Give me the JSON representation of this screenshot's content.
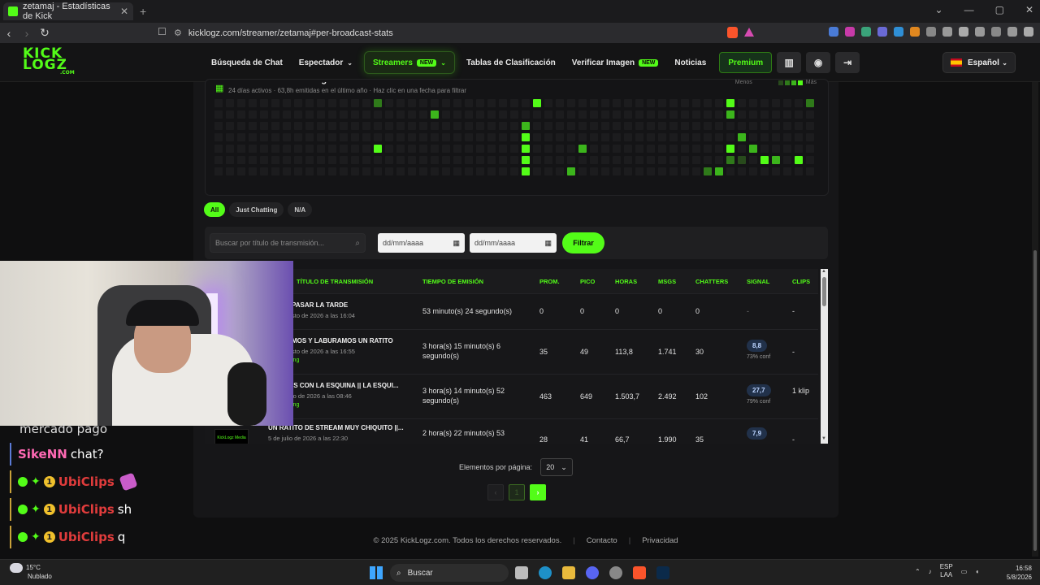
{
  "browser": {
    "tab_title": "zetamaj - Estadísticas de Kick",
    "tab_close": "✕",
    "new_tab": "+",
    "url": "kicklogz.com/streamer/zetamaj#per-broadcast-stats",
    "window_controls": [
      "⌄",
      "—",
      "▢",
      "✕"
    ]
  },
  "site": {
    "logo_line1": "KICK",
    "logo_line2": "LOGZ",
    "logo_suffix": ".COM",
    "nav": [
      {
        "label": "Búsqueda de Chat"
      },
      {
        "label": "Espectador",
        "chevron": "⌄"
      },
      {
        "label": "Streamers",
        "badge": "NEW",
        "chevron": "⌄",
        "active": true
      },
      {
        "label": "Tablas de Clasificación"
      },
      {
        "label": "Verificar Imagen",
        "badge": "NEW"
      },
      {
        "label": "Noticias"
      }
    ],
    "premium_label": "Premium",
    "language": "Español"
  },
  "activity": {
    "title": "Actividad de streaming",
    "subtitle": "24 días activos · 63,8h emitidas en el último año · Haz clic en una fecha para filtrar",
    "legend_less": "Menos",
    "legend_more": "Más",
    "colors": [
      "#1c1c1e",
      "#284a1c",
      "#2f7a1a",
      "#3cb51c",
      "#53fc18"
    ]
  },
  "filters": {
    "pills": [
      {
        "label": "All",
        "active": true
      },
      {
        "label": "Just Chatting",
        "active": false
      },
      {
        "label": "N/A",
        "active": false
      }
    ],
    "search_placeholder": "Buscar por título de transmisión...",
    "date_from": "dd/mm/aaaa",
    "date_to": "dd/mm/aaaa",
    "filter_button": "Filtrar"
  },
  "table": {
    "headers": [
      "TÍTULO DE TRANSMISIÓN",
      "TIEMPO DE EMISIÓN",
      "PROM.",
      "PICO",
      "HORAS",
      "MSGS",
      "CHATTERS",
      "SIGNAL",
      "CLIPS"
    ],
    "rows": [
      {
        "title": "PASAR LA TARDE",
        "date": "sto de 2026 a las 16:04",
        "category": "",
        "duration": "53 minuto(s) 24 segundo(s)",
        "avg": "0",
        "peak": "0",
        "hours": "0",
        "msgs": "0",
        "chatters": "0",
        "signal": "",
        "signal_conf": "",
        "signal_dash": "-",
        "clips": "-"
      },
      {
        "title": "MOS Y LABURAMOS UN RATITO",
        "date": "sto de 2026 a las 16:55",
        "category": "ing",
        "duration": "3 hora(s) 15 minuto(s) 6 segundo(s)",
        "avg": "35",
        "peak": "49",
        "hours": "113,8",
        "msgs": "1.741",
        "chatters": "30",
        "signal": "8,8",
        "signal_conf": "73% conf",
        "signal_dash": "",
        "clips": "-"
      },
      {
        "title": "IS CON LA ESQUINA || LA ESQUI...",
        "date": "io de 2026 a las 08:46",
        "category": "ing",
        "duration": "3 hora(s) 14 minuto(s) 52 segundo(s)",
        "avg": "463",
        "peak": "649",
        "hours": "1.503,7",
        "msgs": "2.492",
        "chatters": "102",
        "signal": "27,7",
        "signal_conf": "79% conf",
        "signal_dash": "",
        "clips": "1 klip"
      },
      {
        "title": "UN RATITO DE STREAM MUY CHIQUITO ||...",
        "date": "5 de julio de 2026 a las 22:30",
        "category": "",
        "duration": "2 hora(s) 22 minuto(s) 53",
        "avg": "28",
        "peak": "41",
        "hours": "66,7",
        "msgs": "1.990",
        "chatters": "35",
        "signal": "7,9",
        "signal_conf": "",
        "signal_dash": "",
        "clips": "-",
        "thumb": "KickLogz Media"
      }
    ]
  },
  "pagination": {
    "per_page_label": "Elementos por página:",
    "per_page_value": "20",
    "prev": "‹",
    "current": "1",
    "next": "›"
  },
  "footer": {
    "copyright": "© 2025 KickLogz.com. Todos los derechos reservados.",
    "contact": "Contacto",
    "privacy": "Privacidad",
    "sep": "|"
  },
  "chat": [
    {
      "user": "",
      "text": "mercado pago",
      "color": "#ffffff"
    },
    {
      "user": "SikeNN",
      "text": "chat?",
      "color": "#ff69b4"
    },
    {
      "user": "UbiClips",
      "text": "",
      "color": "#e03c3c",
      "emote": true
    },
    {
      "user": "UbiClips",
      "text": "sh",
      "color": "#e03c3c"
    },
    {
      "user": "UbiClips",
      "text": "q",
      "color": "#e03c3c"
    }
  ],
  "taskbar": {
    "temperature": "15°C",
    "weather": "Nublado",
    "search_label": "Buscar",
    "lang_line1": "ESP",
    "lang_line2": "LAA",
    "time": "16:58",
    "date": "5/8/2026"
  }
}
